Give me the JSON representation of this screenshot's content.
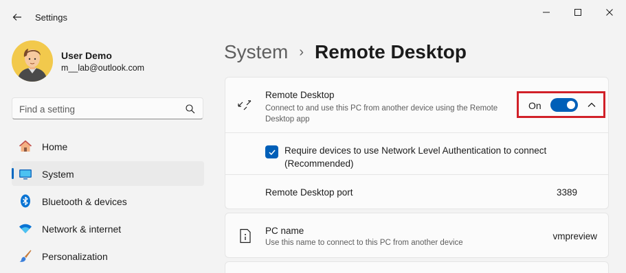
{
  "window": {
    "app_title": "Settings"
  },
  "user": {
    "name": "User Demo",
    "email": "m__lab@outlook.com"
  },
  "search": {
    "placeholder": "Find a setting"
  },
  "sidebar": {
    "items": [
      {
        "label": "Home",
        "icon": "home-icon"
      },
      {
        "label": "System",
        "icon": "system-icon",
        "active": true
      },
      {
        "label": "Bluetooth & devices",
        "icon": "bluetooth-icon"
      },
      {
        "label": "Network & internet",
        "icon": "wifi-icon"
      },
      {
        "label": "Personalization",
        "icon": "brush-icon"
      }
    ]
  },
  "breadcrumb": {
    "parent": "System",
    "separator": "›",
    "current": "Remote Desktop"
  },
  "remote_desktop": {
    "title": "Remote Desktop",
    "description": "Connect to and use this PC from another device using the Remote Desktop app",
    "toggle_state": "On",
    "toggle_on": true
  },
  "nla": {
    "label": "Require devices to use Network Level Authentication to connect (Recommended)",
    "checked": true
  },
  "port": {
    "label": "Remote Desktop port",
    "value": "3389"
  },
  "pc_name": {
    "title": "PC name",
    "description": "Use this name to connect to this PC from another device",
    "value": "vmpreview"
  },
  "colors": {
    "accent": "#005fb8",
    "highlight": "#d12028"
  }
}
